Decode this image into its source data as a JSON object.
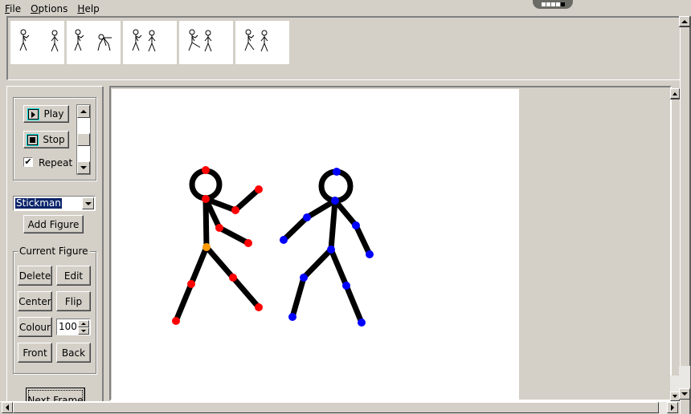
{
  "menu": {
    "items": [
      {
        "label": "File",
        "accel": "F",
        "rest": "ile"
      },
      {
        "label": "Options",
        "accel": "O",
        "rest": "ptions"
      },
      {
        "label": "Help",
        "accel": "H",
        "rest": "elp"
      }
    ]
  },
  "indicator": {
    "total": 5,
    "active": 5
  },
  "timeline": {
    "frames": [
      {
        "index": 1,
        "label": "frame 1"
      },
      {
        "index": 2,
        "label": "frame 2"
      },
      {
        "index": 3,
        "label": "frame 3"
      },
      {
        "index": 4,
        "label": "frame 4"
      },
      {
        "index": 5,
        "label": "frame 5"
      }
    ]
  },
  "playback": {
    "play_label": "Play",
    "stop_label": "Stop",
    "repeat_label": "Repeat",
    "repeat_checked": true
  },
  "figure_select": {
    "value": "Stickman"
  },
  "add_figure_label": "Add Figure",
  "current_figure": {
    "title": "Current Figure",
    "delete_label": "Delete",
    "edit_label": "Edit",
    "center_label": "Center",
    "flip_label": "Flip",
    "colour_label": "Colour",
    "opacity_value": "100",
    "front_label": "Front",
    "back_label": "Back"
  },
  "next_frame_label": "Next Frame",
  "colors": {
    "red_joint": "#ff0000",
    "blue_joint": "#0000ff",
    "origin_joint": "#ff9900",
    "limb": "#000000"
  },
  "figures": [
    {
      "name": "red-stickman",
      "joint_color": "#ff0000"
    },
    {
      "name": "blue-stickman",
      "joint_color": "#0000ff"
    }
  ]
}
